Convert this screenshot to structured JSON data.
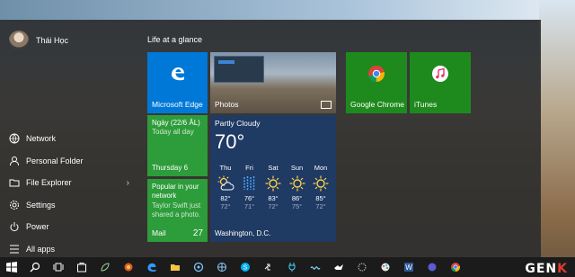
{
  "user": {
    "name": "Thái Học"
  },
  "left_menu": [
    {
      "label": "Network",
      "icon": "network-icon"
    },
    {
      "label": "Personal Folder",
      "icon": "person-icon"
    },
    {
      "label": "File Explorer",
      "icon": "folder-icon",
      "has_arrow": true
    },
    {
      "label": "Settings",
      "icon": "gear-icon"
    },
    {
      "label": "Power",
      "icon": "power-icon"
    },
    {
      "label": "All apps",
      "icon": "list-icon"
    }
  ],
  "group_title": "Life at a glance",
  "tiles": {
    "edge": {
      "label": "Microsoft Edge"
    },
    "photos": {
      "label": "Photos"
    },
    "chrome": {
      "label": "Google Chrome"
    },
    "itunes": {
      "label": "iTunes"
    },
    "calendar": {
      "line1": "Ngày (22/6 ÂL)",
      "line2": "Today all day",
      "day": "Thursday 6"
    },
    "mail": {
      "line1": "Popular in your network",
      "line2": "Taylor Swift just shared a photo.",
      "label": "Mail",
      "count": "27"
    },
    "weather": {
      "condition": "Partly Cloudy",
      "temp": "70°",
      "location": "Washington, D.C.",
      "forecast": [
        {
          "day": "Thu",
          "icon": "partly-sunny-icon",
          "hi": "82°",
          "lo": "72°"
        },
        {
          "day": "Fri",
          "icon": "rain-icon",
          "hi": "76°",
          "lo": "71°"
        },
        {
          "day": "Sat",
          "icon": "sun-icon",
          "hi": "83°",
          "lo": "72°"
        },
        {
          "day": "Sun",
          "icon": "sun-icon",
          "hi": "86°",
          "lo": "75°"
        },
        {
          "day": "Mon",
          "icon": "sun-icon",
          "hi": "85°",
          "lo": "72°"
        }
      ]
    }
  },
  "watermark": {
    "text_a": "GEN",
    "text_b": "K"
  }
}
